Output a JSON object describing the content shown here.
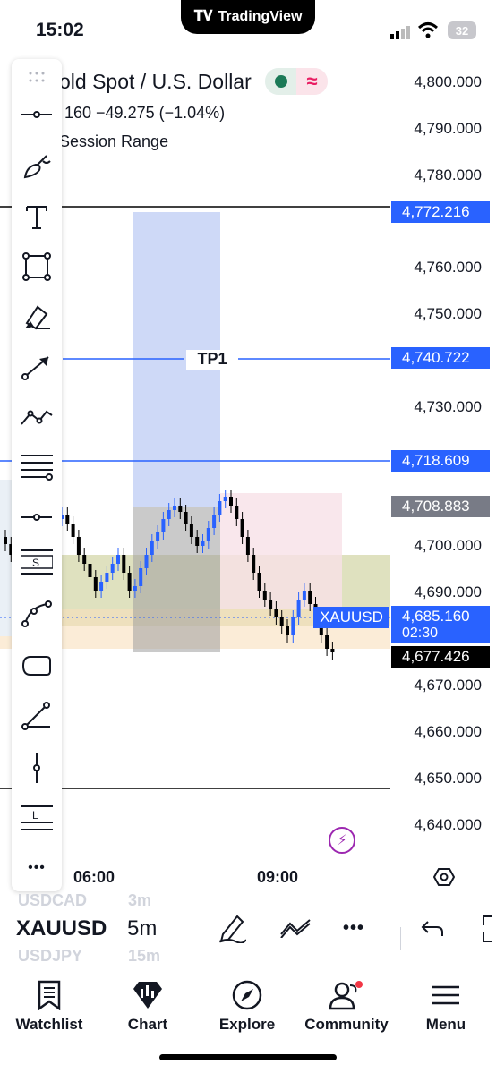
{
  "status": {
    "time": "15:02",
    "brand": "TradingView",
    "battery": "32"
  },
  "header": {
    "symbol_title": "old Spot / U.S. Dollar",
    "price_change": "160  −49.275 (−1.04%)",
    "indicator": "Session Range",
    "pill_right": "≈"
  },
  "price_axis": {
    "labels": [
      "4,800.000",
      "4,790.000",
      "4,780.000",
      "4,760.000",
      "4,750.000",
      "4,730.000",
      "4,700.000",
      "4,690.000",
      "4,670.000",
      "4,660.000",
      "4,650.000",
      "4,640.000"
    ],
    "tags": {
      "line1": "4,772.216",
      "tp1": "4,740.722",
      "line3": "4,718.609",
      "gray": "4,708.883",
      "current": "4,685.160",
      "countdown": "02:30",
      "black": "4,677.426"
    },
    "symbol_tag": "XAUUSD"
  },
  "drawing": {
    "tp1_label": "TP1"
  },
  "time_axis": [
    "06:00",
    "09:00"
  ],
  "symbol_row": {
    "symbol": "XAUUSD",
    "interval": "5m",
    "ghost_above_symbol": "USDCAD",
    "ghost_above_interval": "3m",
    "ghost_below_symbol": "USDJPY",
    "ghost_below_interval": "15m",
    "more": "•••"
  },
  "toolbar": {
    "more": "•••"
  },
  "nav": {
    "items": [
      {
        "label": "Watchlist"
      },
      {
        "label": "Chart"
      },
      {
        "label": "Explore"
      },
      {
        "label": "Community"
      },
      {
        "label": "Menu"
      }
    ]
  },
  "colors": {
    "accent": "#2962ff",
    "up": "#2962ff",
    "down": "#000000",
    "tp_zone": "#c5d2f6",
    "sl_zone": "#f8e1e7"
  }
}
